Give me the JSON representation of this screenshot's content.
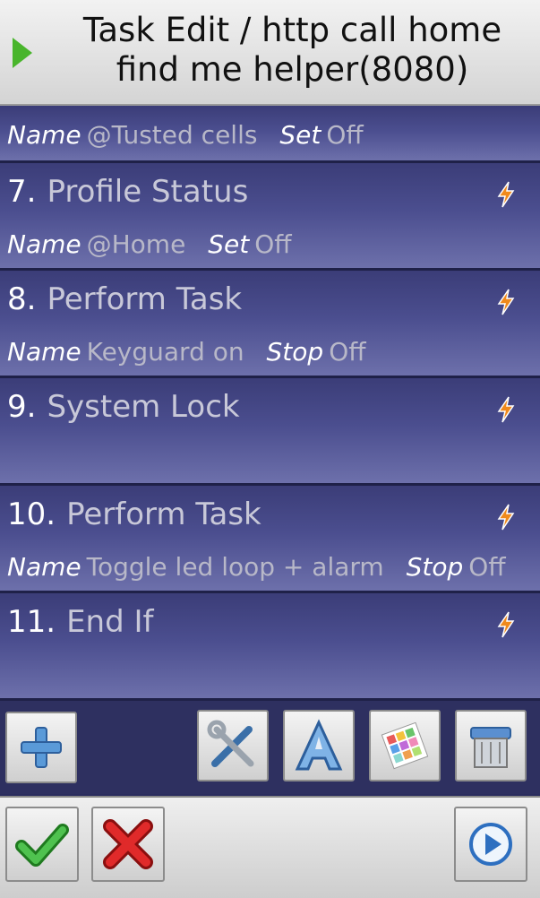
{
  "header": {
    "title": "Task Edit / http call home find me helper(8080)"
  },
  "rows": [
    {
      "number": "",
      "title": "",
      "params": [
        {
          "key": "Name",
          "value": "@Tusted cells"
        },
        {
          "key": "Set",
          "value": "Off"
        }
      ]
    },
    {
      "number": "7.",
      "title": "Profile Status",
      "params": [
        {
          "key": "Name",
          "value": "@Home"
        },
        {
          "key": "Set",
          "value": "Off"
        }
      ]
    },
    {
      "number": "8.",
      "title": "Perform Task",
      "params": [
        {
          "key": "Name",
          "value": "Keyguard on"
        },
        {
          "key": "Stop",
          "value": "Off"
        }
      ]
    },
    {
      "number": "9.",
      "title": "System Lock",
      "params": []
    },
    {
      "number": "10.",
      "title": "Perform Task",
      "params": [
        {
          "key": "Name",
          "value": "Toggle led loop + alarm"
        },
        {
          "key": "Stop",
          "value": "Off"
        }
      ]
    },
    {
      "number": "11.",
      "title": "End If",
      "params": []
    }
  ],
  "toolbar": {
    "icons": [
      "plus-icon",
      "tools-icon",
      "text-icon",
      "palette-icon",
      "trash-icon"
    ]
  },
  "bottom": {
    "icons": [
      "checkmark-icon",
      "cancel-icon",
      "play-icon"
    ]
  },
  "colors": {
    "accent_green": "#49b52c",
    "bolt_orange": "#f08a1c",
    "row_bg": "#4b4e8f"
  }
}
